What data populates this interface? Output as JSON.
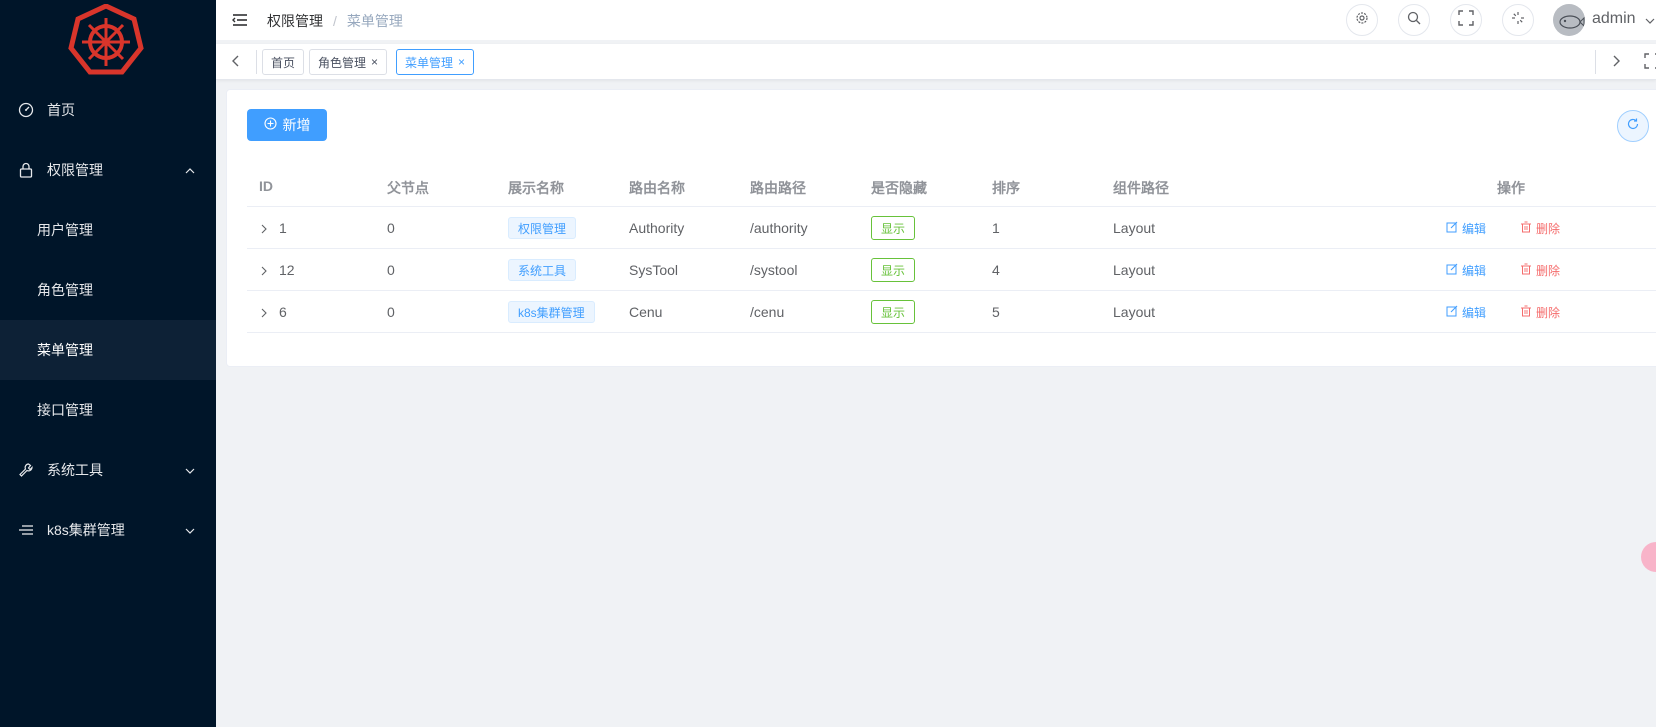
{
  "sidebar": {
    "logo_icon": "kubernetes-helm-icon",
    "items": [
      {
        "label": "首页",
        "icon": "dashboard-icon"
      },
      {
        "label": "权限管理",
        "icon": "lock-icon"
      },
      {
        "label": "用户管理"
      },
      {
        "label": "角色管理"
      },
      {
        "label": "菜单管理"
      },
      {
        "label": "接口管理"
      },
      {
        "label": "系统工具",
        "icon": "wrench-icon"
      },
      {
        "label": "k8s集群管理",
        "icon": "list-icon"
      }
    ]
  },
  "header": {
    "breadcrumb": [
      "权限管理",
      "菜单管理"
    ],
    "separator": "/",
    "username": "admin"
  },
  "tabs": [
    {
      "label": "首页"
    },
    {
      "label": "角色管理",
      "close": "×"
    },
    {
      "label": "菜单管理",
      "close": "×"
    }
  ],
  "toolbar": {
    "add_label": "新增"
  },
  "table": {
    "columns": [
      "ID",
      "父节点",
      "展示名称",
      "路由名称",
      "路由路径",
      "是否隐藏",
      "排序",
      "组件路径",
      "操作"
    ],
    "rows": [
      {
        "id": "1",
        "parent": "0",
        "display": "权限管理",
        "route_name": "Authority",
        "route_path": "/authority",
        "hidden": "显示",
        "sort": "1",
        "component": "Layout",
        "edit": "编辑",
        "delete": "删除"
      },
      {
        "id": "12",
        "parent": "0",
        "display": "系统工具",
        "route_name": "SysTool",
        "route_path": "/systool",
        "hidden": "显示",
        "sort": "4",
        "component": "Layout",
        "edit": "编辑",
        "delete": "删除"
      },
      {
        "id": "6",
        "parent": "0",
        "display": "k8s集群管理",
        "route_name": "Cenu",
        "route_path": "/cenu",
        "hidden": "显示",
        "sort": "5",
        "component": "Layout",
        "edit": "编辑",
        "delete": "删除"
      }
    ]
  },
  "colors": {
    "sidebar_bg": "#001529",
    "primary": "#409eff",
    "success": "#67c23a",
    "danger": "#f56c6c",
    "logo": "#e53935"
  }
}
